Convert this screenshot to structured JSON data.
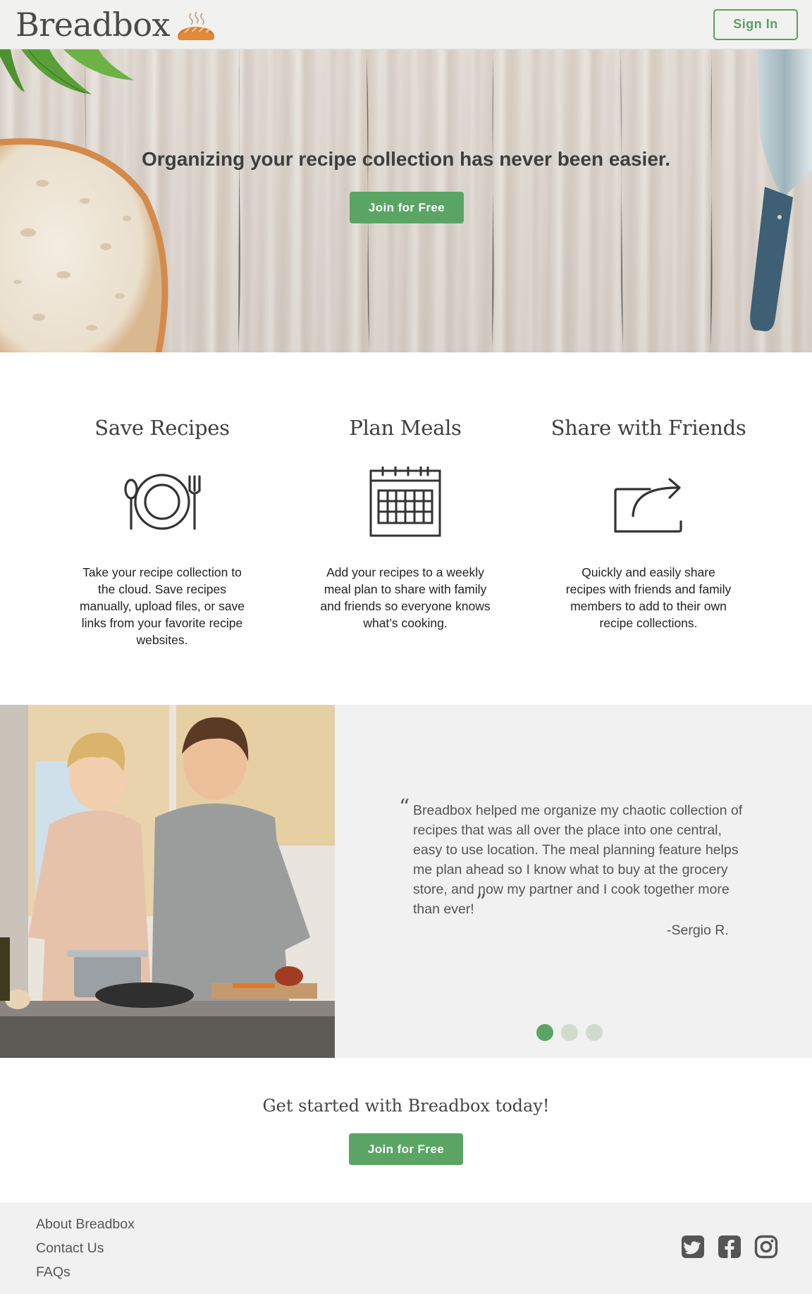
{
  "header": {
    "brand_name": "Breadbox",
    "sign_in_label": "Sign In"
  },
  "hero": {
    "title": "Organizing your recipe collection has never been easier.",
    "cta_label": "Join for Free"
  },
  "features": [
    {
      "title": "Save Recipes",
      "icon": "plate-fork-knife-icon",
      "description": "Take your recipe collection to the cloud. Save recipes manually, upload files, or save links from your favorite recipe websites."
    },
    {
      "title": "Plan Meals",
      "icon": "calendar-icon",
      "description": "Add your recipes to a weekly meal plan to share with family and friends so everyone knows what’s cooking."
    },
    {
      "title": "Share with Friends",
      "icon": "share-arrow-icon",
      "description": "Quickly and easily share recipes with friends and family members to add to their own recipe collections."
    }
  ],
  "testimonial": {
    "quote": "Breadbox helped me organize my chaotic collection of recipes that was all over the place into one central, easy to use location. The meal planning feature helps me plan ahead so I know what to buy at the grocery store, and now my partner and I cook together more than ever!",
    "author": "-Sergio R.",
    "slides_total": 3,
    "active_slide": 1
  },
  "cta": {
    "title": "Get started with Breadbox today!",
    "button_label": "Join for Free"
  },
  "footer": {
    "links": [
      "About Breadbox",
      "Contact Us",
      "FAQs"
    ],
    "social": [
      "twitter-icon",
      "facebook-icon",
      "instagram-icon"
    ]
  },
  "colors": {
    "accent_green": "#5aa564",
    "header_bg": "#f1f1ef",
    "section_gray": "#f1f1f1",
    "dot_inactive": "#cfdccc"
  }
}
